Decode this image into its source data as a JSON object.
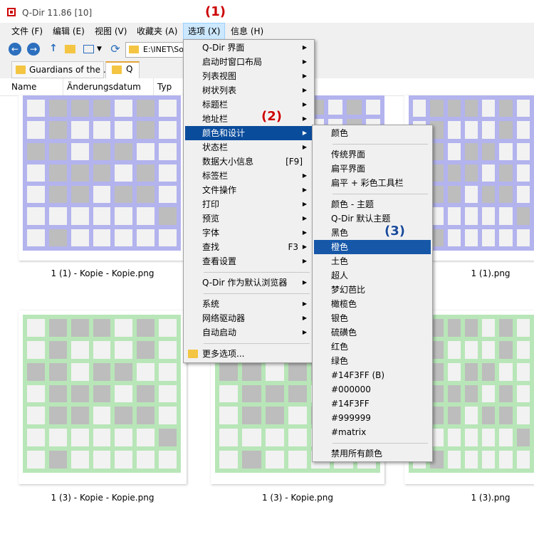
{
  "window": {
    "title": "Q-Dir 11.86 [10]"
  },
  "menubar": [
    {
      "label": "文件 (F)"
    },
    {
      "label": "编辑 (E)"
    },
    {
      "label": "视图 (V)"
    },
    {
      "label": "收藏夹 (A)"
    },
    {
      "label": "选项 (X)"
    },
    {
      "label": "信息 (H)"
    }
  ],
  "toolbar": {
    "address": "E:\\INET\\So"
  },
  "tabs": [
    {
      "label": "Guardians of the ..."
    },
    {
      "label": "Q"
    }
  ],
  "columns": [
    "Name",
    "Änderungsdatum",
    "Typ"
  ],
  "files": [
    {
      "caption": "1 (1) - Kopie - Kopie.png",
      "color": "#b3b3ee"
    },
    {
      "caption": "",
      "color": "#b3b3ee"
    },
    {
      "caption": "1 (1).png",
      "color": "#b3b3ee"
    },
    {
      "caption": "1 (3) - Kopie - Kopie.png",
      "color": "#b8e6b8"
    },
    {
      "caption": "1 (3) - Kopie.png",
      "color": "#b8e6b8"
    },
    {
      "caption": "1 (3).png",
      "color": "#b8e6b8"
    }
  ],
  "options_menu": [
    {
      "label": "Q-Dir 界面",
      "arrow": "▶"
    },
    {
      "label": "启动时窗口布局",
      "arrow": "▶"
    },
    {
      "label": "列表视图",
      "arrow": "▶"
    },
    {
      "label": "树状列表",
      "arrow": "▶"
    },
    {
      "label": "标题栏",
      "arrow": "▶"
    },
    {
      "label": "地址栏",
      "arrow": "▶"
    },
    {
      "label": "颜色和设计",
      "arrow": "▶"
    },
    {
      "label": "状态栏",
      "arrow": "▶"
    },
    {
      "label": "数据大小信息",
      "shortcut": "[F9]"
    },
    {
      "label": "标签栏",
      "arrow": "▶"
    },
    {
      "label": "文件操作",
      "arrow": "▶"
    },
    {
      "label": "打印",
      "arrow": "▶"
    },
    {
      "label": "预览",
      "arrow": "▶"
    },
    {
      "label": "字体",
      "arrow": "▶"
    },
    {
      "label": "查找",
      "shortcut": "F3",
      "arrow": "▶"
    },
    {
      "label": "查看设置",
      "arrow": "▶"
    },
    {
      "label": "Q-Dir 作为默认浏览器",
      "arrow": "▶"
    },
    {
      "label": "系统",
      "arrow": "▶"
    },
    {
      "label": "网络驱动器",
      "arrow": "▶"
    },
    {
      "label": "自动启动",
      "arrow": "▶"
    },
    {
      "label": "更多选项..."
    }
  ],
  "color_menu": [
    {
      "label": "颜色"
    },
    {
      "label": "传统界面"
    },
    {
      "label": "扁平界面"
    },
    {
      "label": "扁平 + 彩色工具栏"
    },
    {
      "label": "颜色 - 主题"
    },
    {
      "label": "Q-Dir 默认主题"
    },
    {
      "label": "黑色"
    },
    {
      "label": "橙色"
    },
    {
      "label": "土色"
    },
    {
      "label": "超人"
    },
    {
      "label": "梦幻芭比"
    },
    {
      "label": "橄榄色"
    },
    {
      "label": "银色"
    },
    {
      "label": "硫磺色"
    },
    {
      "label": "红色"
    },
    {
      "label": "绿色"
    },
    {
      "label": "#14F3FF (B)"
    },
    {
      "label": "#000000"
    },
    {
      "label": "#14F3FF"
    },
    {
      "label": "#999999"
    },
    {
      "label": "#matrix"
    },
    {
      "label": "禁用所有颜色"
    }
  ],
  "steps": [
    "(1)",
    "(2)",
    "(3)"
  ],
  "colors": {
    "highlight": "#0a4c9c",
    "step": "#cc0000",
    "menu_active": "#cce8ff"
  }
}
